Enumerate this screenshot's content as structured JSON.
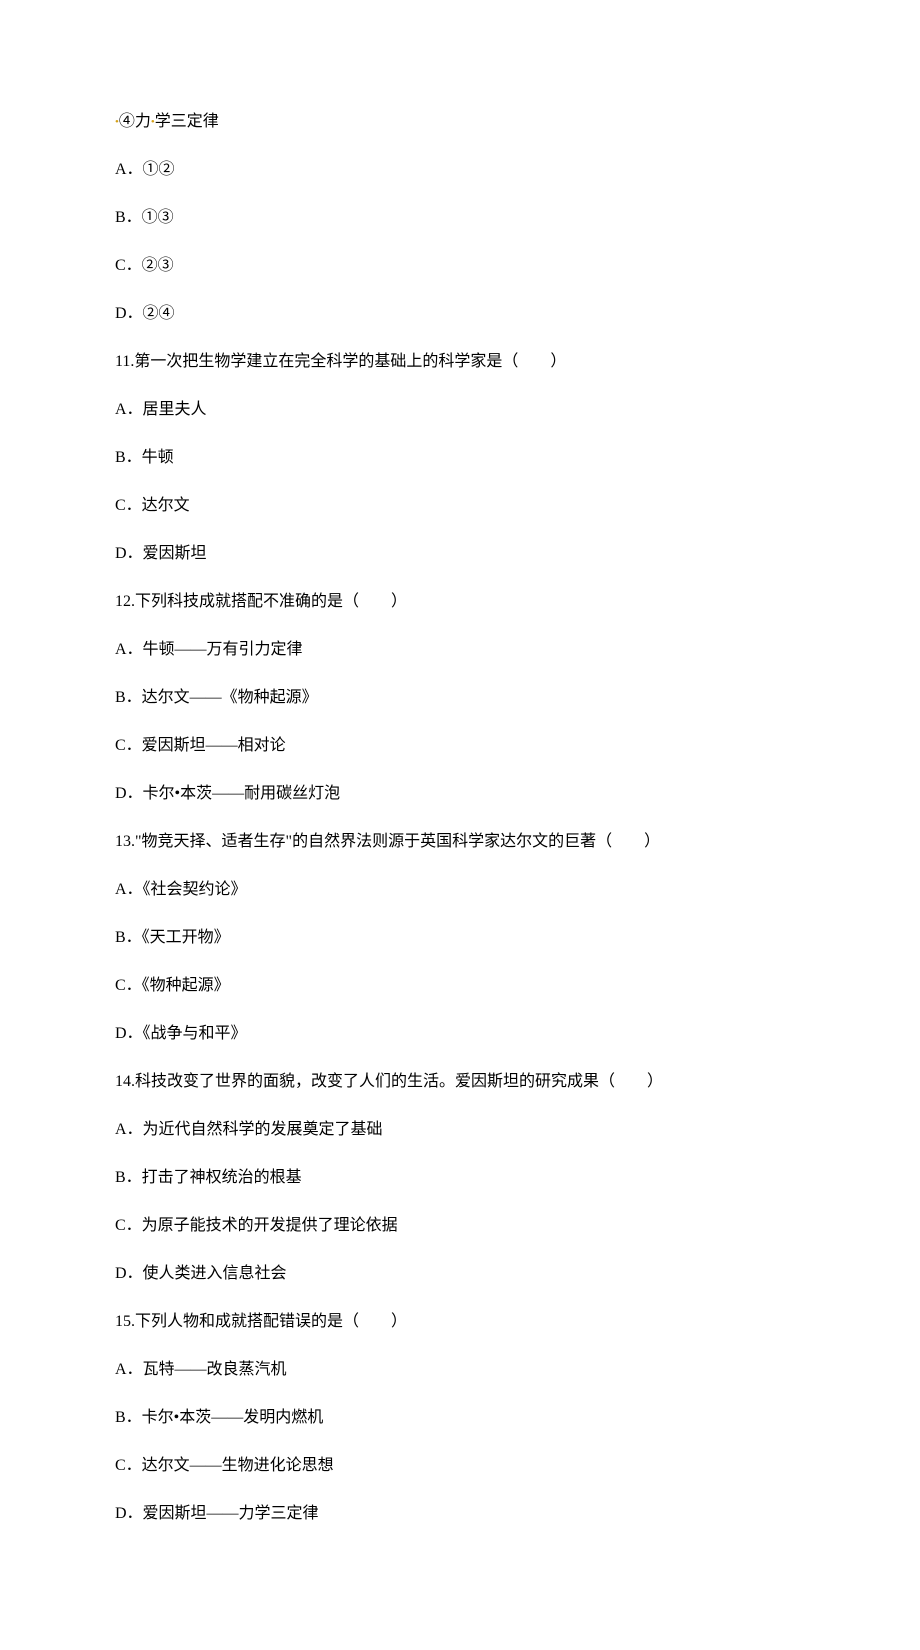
{
  "lines": {
    "l0_pre": "",
    "l0": "④力",
    "l0_post": "学三定律",
    "l1": "A．①②",
    "l2": "B．①③",
    "l3": "C．②③",
    "l4": "D．②④",
    "l5": "11.第一次把生物学建立在完全科学的基础上的科学家是（　　）",
    "l6": "A．居里夫人",
    "l7": "B．牛顿",
    "l8": "C．达尔文",
    "l9": "D．爱因斯坦",
    "l10": "12.下列科技成就搭配不准确的是（　　）",
    "l11": "A．牛顿——万有引力定律",
    "l12": "B．达尔文——《物种起源》",
    "l13": "C．爱因斯坦——相对论",
    "l14": "D．卡尔•本茨——耐用碳丝灯泡",
    "l15": "13.\"物竞天择、适者生存\"的自然界法则源于英国科学家达尔文的巨著（　　）",
    "l16": "A．《社会契约论》",
    "l17": "B．《天工开物》",
    "l18": "C．《物种起源》",
    "l19": "D．《战争与和平》",
    "l20": "14.科技改变了世界的面貌，改变了人们的生活。爱因斯坦的研究成果（　　）",
    "l21": "A．为近代自然科学的发展奠定了基础",
    "l22": "B．打击了神权统治的根基",
    "l23": "C．为原子能技术的开发提供了理论依据",
    "l24": "D．使人类进入信息社会",
    "l25": "15.下列人物和成就搭配错误的是（　　）",
    "l26": "A．瓦特——改良蒸汽机",
    "l27": "B．卡尔•本茨——发明内燃机",
    "l28": "C．达尔文——生物进化论思想",
    "l29": "D．爱因斯坦——力学三定律"
  },
  "dot_glyph": "•"
}
